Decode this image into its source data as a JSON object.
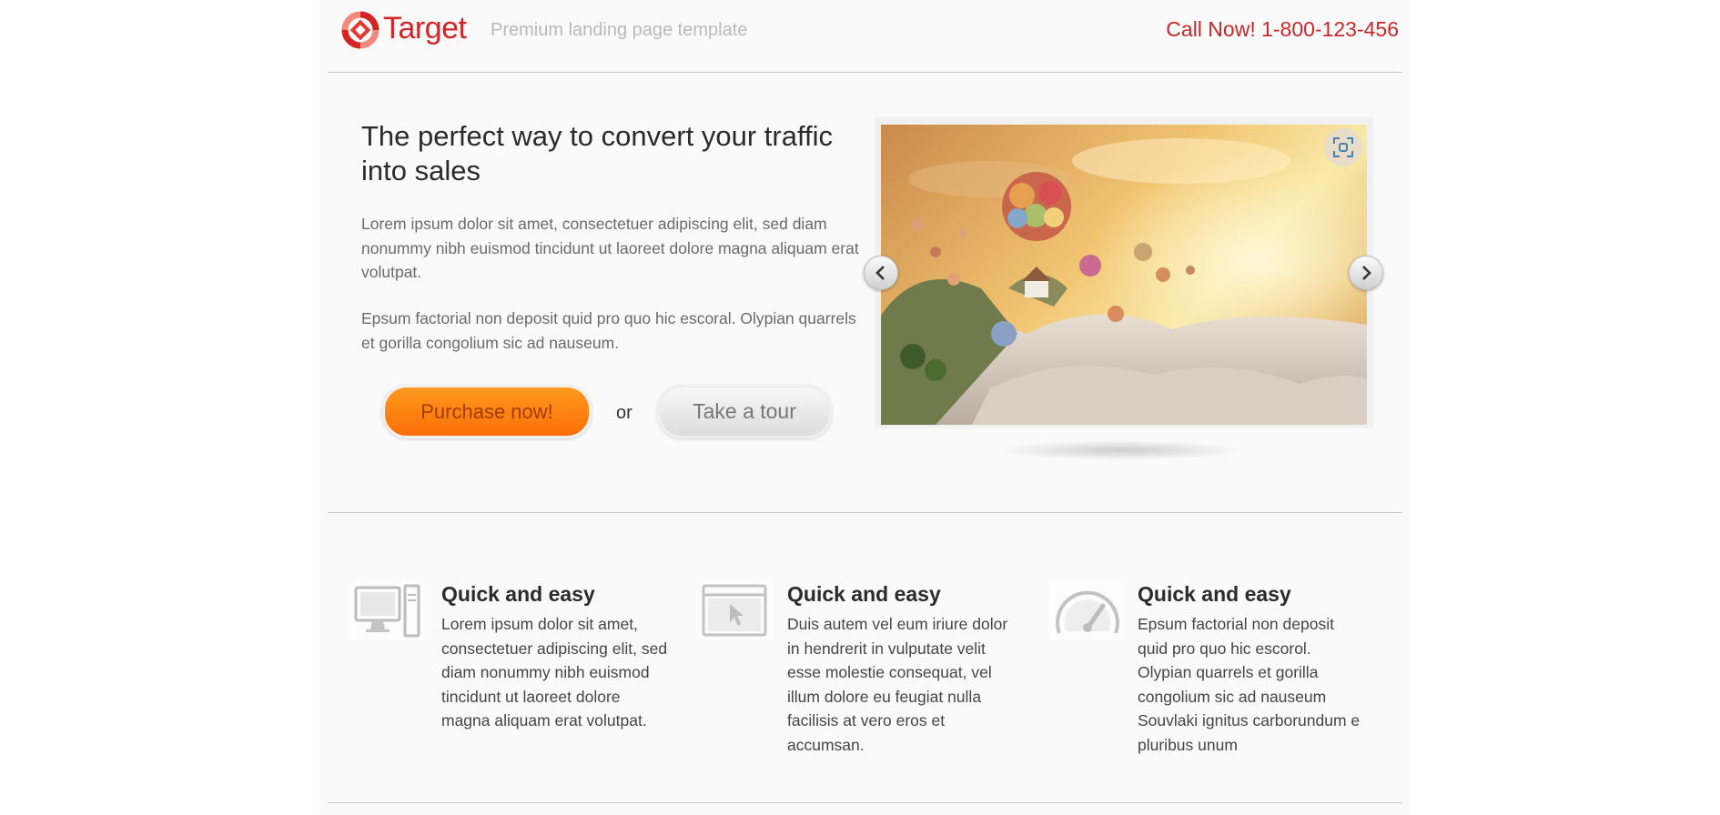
{
  "header": {
    "brand": "Target",
    "tagline": "Premium landing page template",
    "call": "Call Now! 1-800-123-456"
  },
  "hero": {
    "title": "The perfect way to convert your traffic into sales",
    "paragraph1": "Lorem ipsum dolor sit amet, consectetuer adipiscing elit, sed diam nonummy nibh euismod tincidunt ut laoreet dolore magna aliquam erat volutpat.",
    "paragraph2": "Epsum factorial non deposit quid pro quo hic escoral. Olypian quarrels et gorilla congolium sic ad nauseum.",
    "purchase_label": "Purchase now!",
    "or_label": "or",
    "tour_label": "Take a tour"
  },
  "slider": {
    "prev_icon": "chevron-left-icon",
    "next_icon": "chevron-right-icon",
    "fullscreen_icon": "fullscreen-icon"
  },
  "features": [
    {
      "icon": "desktop-computer-icon",
      "title": "Quick and easy",
      "text": "Lorem ipsum dolor sit amet, consectetuer adipiscing elit, sed diam nonummy nibh euismod tincidunt ut laoreet dolore magna aliquam erat volutpat."
    },
    {
      "icon": "browser-cursor-icon",
      "title": "Quick and easy",
      "text": "Duis autem vel eum iriure dolor in hendrerit in vulputate velit esse molestie consequat, vel illum dolore eu feugiat nulla facilisis at vero eros et accumsan."
    },
    {
      "icon": "speedometer-icon",
      "title": "Quick and easy",
      "text": "Epsum factorial non deposit quid pro quo hic escorol. Olypian quarrels et gorilla congolium sic ad nauseum Souvlaki ignitus carborundum e pluribus unum"
    }
  ],
  "colors": {
    "brand_red": "#d42426",
    "button_orange": "#fb7a0c",
    "page_bg": "#fafafa"
  }
}
